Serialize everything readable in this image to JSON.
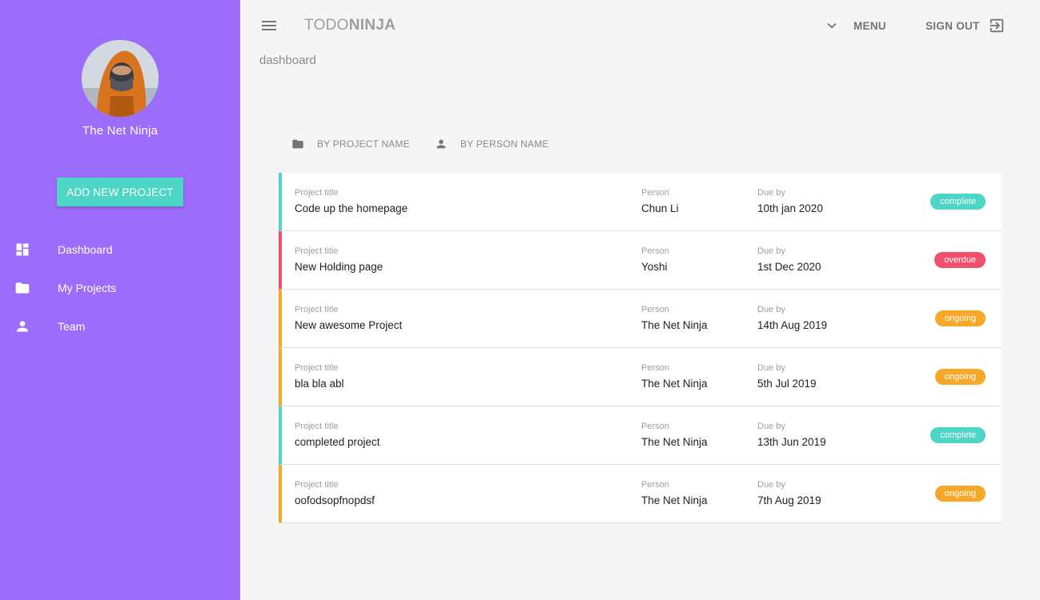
{
  "sidebar": {
    "username": "The Net Ninja",
    "add_button": "ADD NEW PROJECT",
    "items": [
      {
        "label": "Dashboard",
        "icon": "dashboard-icon"
      },
      {
        "label": "My Projects",
        "icon": "folder-icon"
      },
      {
        "label": "Team",
        "icon": "person-icon"
      }
    ]
  },
  "toolbar": {
    "brand_light": "TODO",
    "brand_bold": "NINJA",
    "menu_label": "MENU",
    "signout_label": "SIGN OUT"
  },
  "page": {
    "heading": "dashboard",
    "sort_by_project": "BY PROJECT NAME",
    "sort_by_person": "BY PERSON NAME"
  },
  "labels": {
    "title": "Project title",
    "person": "Person",
    "due": "Due by"
  },
  "colors": {
    "sidebar": "#9c6cfa",
    "accent": "#4dd6c5",
    "complete": "#4dd6c5",
    "overdue": "#f0506e",
    "ongoing": "#f7a828"
  },
  "projects": [
    {
      "title": "Code up the homepage",
      "person": "Chun Li",
      "due": "10th jan 2020",
      "status": "complete"
    },
    {
      "title": "New Holding page",
      "person": "Yoshi",
      "due": "1st Dec 2020",
      "status": "overdue"
    },
    {
      "title": "New awesome Project",
      "person": "The Net Ninja",
      "due": "14th Aug 2019",
      "status": "ongoing"
    },
    {
      "title": "bla bla abl",
      "person": "The Net Ninja",
      "due": "5th Jul 2019",
      "status": "ongoing"
    },
    {
      "title": "completed project",
      "person": "The Net Ninja",
      "due": "13th Jun 2019",
      "status": "complete"
    },
    {
      "title": "oofodsopfnopdsf",
      "person": "The Net Ninja",
      "due": "7th Aug 2019",
      "status": "ongoing"
    }
  ]
}
